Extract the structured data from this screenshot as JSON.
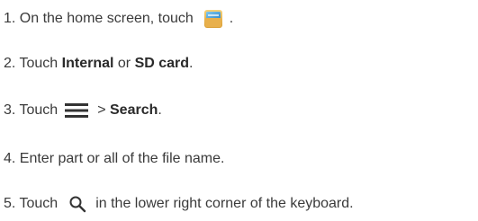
{
  "steps": [
    {
      "prefix": "1. On the home screen, touch",
      "icon": "file-manager-icon",
      "suffix": "."
    },
    {
      "prefix": "2. Touch ",
      "bold1": "Internal",
      "middle": " or ",
      "bold2": "SD card",
      "suffix": "."
    },
    {
      "prefix": "3. Touch",
      "icon": "menu-icon",
      "middle": "> ",
      "bold1": "Search",
      "suffix": "."
    },
    {
      "text": "4. Enter part or all of the file name."
    },
    {
      "prefix": "5. Touch",
      "icon": "search-icon",
      "suffix": "in the lower right corner of the keyboard."
    }
  ],
  "colors": {
    "text": "#3a3a3a",
    "icon_dark": "#333333"
  }
}
